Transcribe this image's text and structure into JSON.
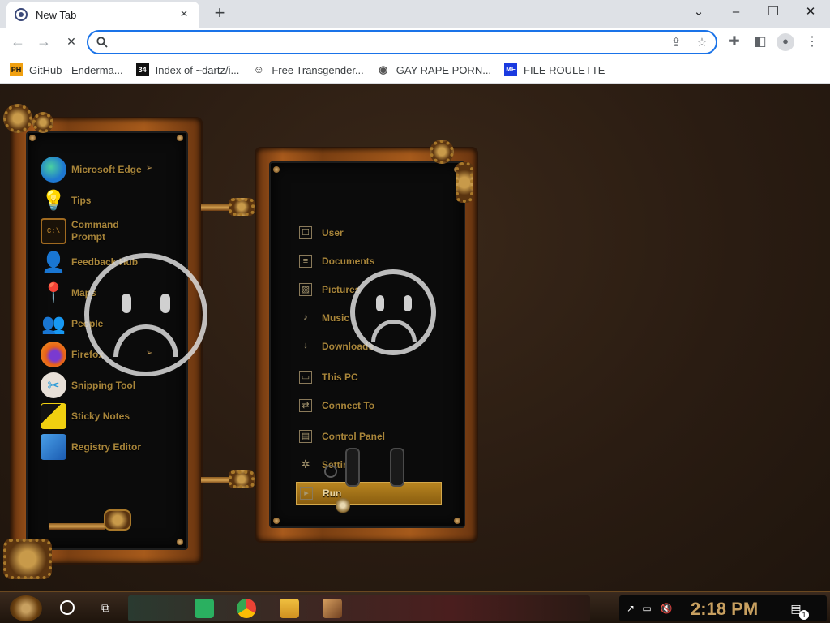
{
  "browser": {
    "tab_title": "New Tab",
    "tab_close": "×",
    "new_tab": "+",
    "window_controls": {
      "minimize": "–",
      "restore": "❐",
      "close": "✕",
      "tab_search": "⌄"
    },
    "nav": {
      "back": "←",
      "forward": "→",
      "reload": "✕"
    },
    "omnibox": {
      "value": "",
      "placeholder": ""
    },
    "bookmarks": [
      {
        "label": "GitHub - Enderma...",
        "icon": "PH",
        "icon_bg": "#f0a010",
        "icon_fg": "#111"
      },
      {
        "label": "Index of ~dartz/i...",
        "icon": "34",
        "icon_bg": "#111",
        "icon_fg": "#fff"
      },
      {
        "label": "Free Transgender...",
        "icon": "☺",
        "icon_bg": "#fff",
        "icon_fg": "#333"
      },
      {
        "label": "GAY RAPE PORN...",
        "icon": "◉",
        "icon_bg": "#fff",
        "icon_fg": "#555"
      },
      {
        "label": "FILE ROULETTE",
        "icon": "MF",
        "icon_bg": "#1a3ae0",
        "icon_fg": "#fff"
      }
    ]
  },
  "start_menu": {
    "apps": [
      {
        "label": "Microsoft Edge",
        "icon": "edge-icon",
        "color": "#1e90d0",
        "has_arrow": true
      },
      {
        "label": "Tips",
        "icon": "lightbulb-icon",
        "color": "#d48a20",
        "has_arrow": false
      },
      {
        "label": "Command Prompt",
        "icon": "terminal-icon",
        "color": "#c07a20",
        "has_arrow": false
      },
      {
        "label": "Feedback Hub",
        "icon": "feedback-icon",
        "color": "#c07a20",
        "has_arrow": false
      },
      {
        "label": "Maps",
        "icon": "map-pin-icon",
        "color": "#c07a20",
        "has_arrow": false
      },
      {
        "label": "People",
        "icon": "people-icon",
        "color": "#c07a20",
        "has_arrow": false
      },
      {
        "label": "Firefox",
        "icon": "firefox-icon",
        "color": "#e8601a",
        "has_arrow": true
      },
      {
        "label": "Snipping Tool",
        "icon": "scissors-icon",
        "color": "#2a9ad8",
        "has_arrow": false
      },
      {
        "label": "Sticky Notes",
        "icon": "sticky-note-icon",
        "color": "#f0d010",
        "has_arrow": false
      },
      {
        "label": "Registry Editor",
        "icon": "registry-icon",
        "color": "#2a7ad8",
        "has_arrow": false
      }
    ],
    "places": [
      {
        "label": "User",
        "icon": "user-icon",
        "glyph": "☐"
      },
      {
        "label": "Documents",
        "icon": "document-icon",
        "glyph": "≡"
      },
      {
        "label": "Pictures",
        "icon": "picture-icon",
        "glyph": "▨"
      },
      {
        "label": "Music",
        "icon": "music-icon",
        "glyph": "♪"
      },
      {
        "label": "Downloads",
        "icon": "download-icon",
        "glyph": "↓"
      },
      {
        "label": "This PC",
        "icon": "monitor-icon",
        "glyph": "▭"
      },
      {
        "label": "Connect To",
        "icon": "network-icon",
        "glyph": "⇄"
      },
      {
        "label": "Control Panel",
        "icon": "control-panel-icon",
        "glyph": "▤"
      },
      {
        "label": "Settings",
        "icon": "gear-icon",
        "glyph": "✲"
      },
      {
        "label": "Run",
        "icon": "run-icon",
        "glyph": "▸",
        "active": true
      }
    ]
  },
  "taskbar": {
    "clock": "2:18 PM",
    "notification_count": "1"
  }
}
